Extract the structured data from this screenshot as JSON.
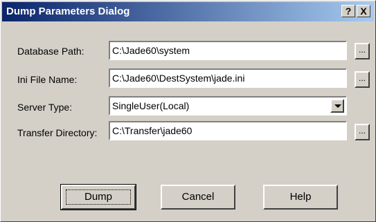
{
  "window": {
    "title": "Dump Parameters Dialog",
    "help_label": "?",
    "close_label": "X"
  },
  "fields": {
    "database_path": {
      "label": "Database Path:",
      "value": "C:\\Jade60\\system",
      "browse_label": "..."
    },
    "ini_file_name": {
      "label": "Ini File Name:",
      "value": "C:\\Jade60\\DestSystem\\jade.ini",
      "browse_label": "..."
    },
    "server_type": {
      "label": "Server Type:",
      "value": "SingleUser(Local)"
    },
    "transfer_directory": {
      "label": "Transfer Directory:",
      "value": "C:\\Transfer\\jade60",
      "browse_label": "..."
    }
  },
  "buttons": {
    "dump": "Dump",
    "cancel": "Cancel",
    "help": "Help"
  }
}
